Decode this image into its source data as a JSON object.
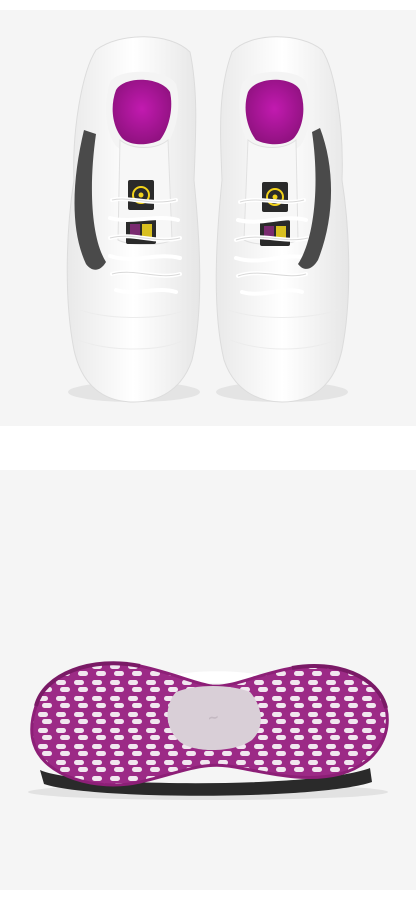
{
  "colors": {
    "background": "#ffffff",
    "panel": "#f5f5f5",
    "upper": "#ffffff",
    "lining": "#b3169e",
    "outsole": "#9c2a86",
    "swoosh": "#4a4a4a",
    "tab_yellow": "#f2d21a",
    "tab_dark": "#2a2a2a"
  },
  "images": [
    {
      "subject": "shoes-top-view"
    },
    {
      "subject": "shoe-outsole-view"
    }
  ]
}
